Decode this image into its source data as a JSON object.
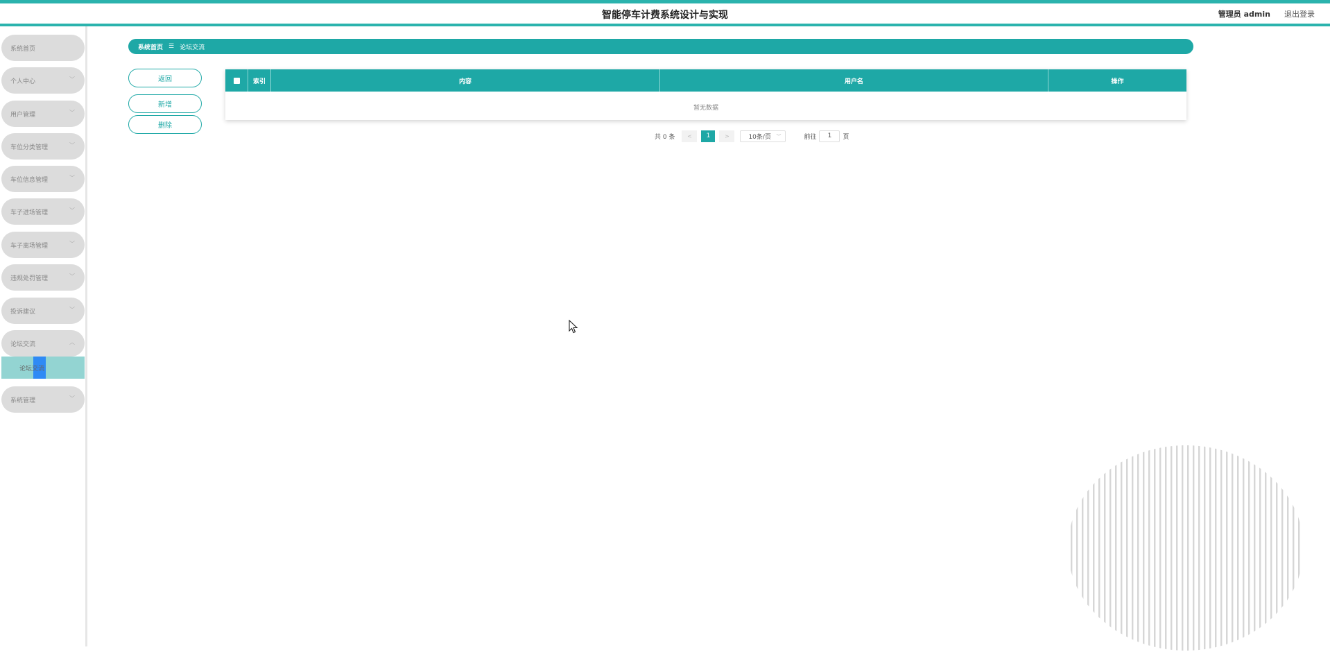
{
  "header": {
    "title": "智能停车计费系统设计与实现",
    "user": "管理员 admin",
    "logout": "退出登录"
  },
  "sidebar": {
    "items": [
      {
        "label": "系统首页",
        "chevron": false
      },
      {
        "label": "个人中心",
        "chevron": true
      },
      {
        "label": "用户管理",
        "chevron": true
      },
      {
        "label": "车位分类管理",
        "chevron": true
      },
      {
        "label": "车位信息管理",
        "chevron": true
      },
      {
        "label": "车子进场管理",
        "chevron": true
      },
      {
        "label": "车子离场管理",
        "chevron": true
      },
      {
        "label": "违规处罚管理",
        "chevron": true
      },
      {
        "label": "投诉建议",
        "chevron": true
      },
      {
        "label": "论坛交流",
        "chevron": true,
        "expanded": true
      },
      {
        "label": "系统管理",
        "chevron": true
      }
    ],
    "active_subitem": "论坛交流"
  },
  "breadcrumb": {
    "home": "系统首页",
    "separator": "☰",
    "current": "论坛交流"
  },
  "actions": {
    "back": "返回",
    "add": "新增",
    "delete": "删除"
  },
  "table": {
    "columns": [
      "索引",
      "内容",
      "用户名",
      "操作"
    ],
    "empty_text": "暂无数据"
  },
  "pagination": {
    "total": "共 0 条",
    "prev": "<",
    "page": "1",
    "next": ">",
    "page_size": "10条/页",
    "goto_label": "前往",
    "goto_value": "1",
    "page_suffix": "页"
  },
  "colors": {
    "accent": "#1ea8a6",
    "header_line": "#2bb3ad",
    "active_submenu": "#93d4d2",
    "menu_bg": "#dcdcdc"
  }
}
